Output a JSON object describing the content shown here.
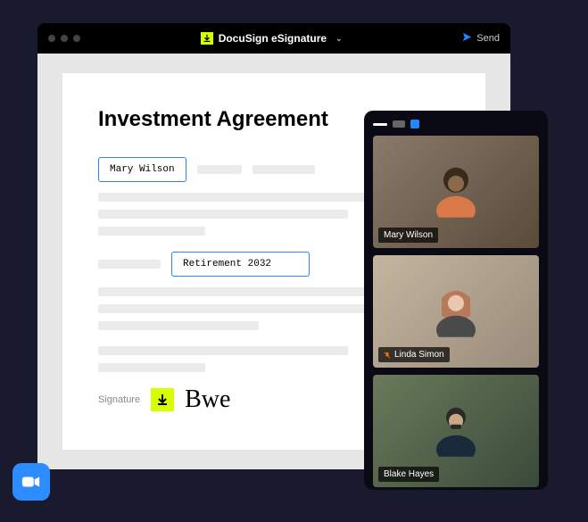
{
  "window": {
    "app_name": "DocuSign eSignature",
    "send_label": "Send"
  },
  "document": {
    "title": "Investment Agreement",
    "field1_value": "Mary Wilson",
    "field2_value": "Retirement 2032",
    "signature_label": "Signature",
    "signature_value": "Bwe"
  },
  "video": {
    "participants": [
      {
        "name": "Mary Wilson",
        "muted": false
      },
      {
        "name": "Linda Simon",
        "muted": true
      },
      {
        "name": "Blake Hayes",
        "muted": false
      }
    ]
  }
}
